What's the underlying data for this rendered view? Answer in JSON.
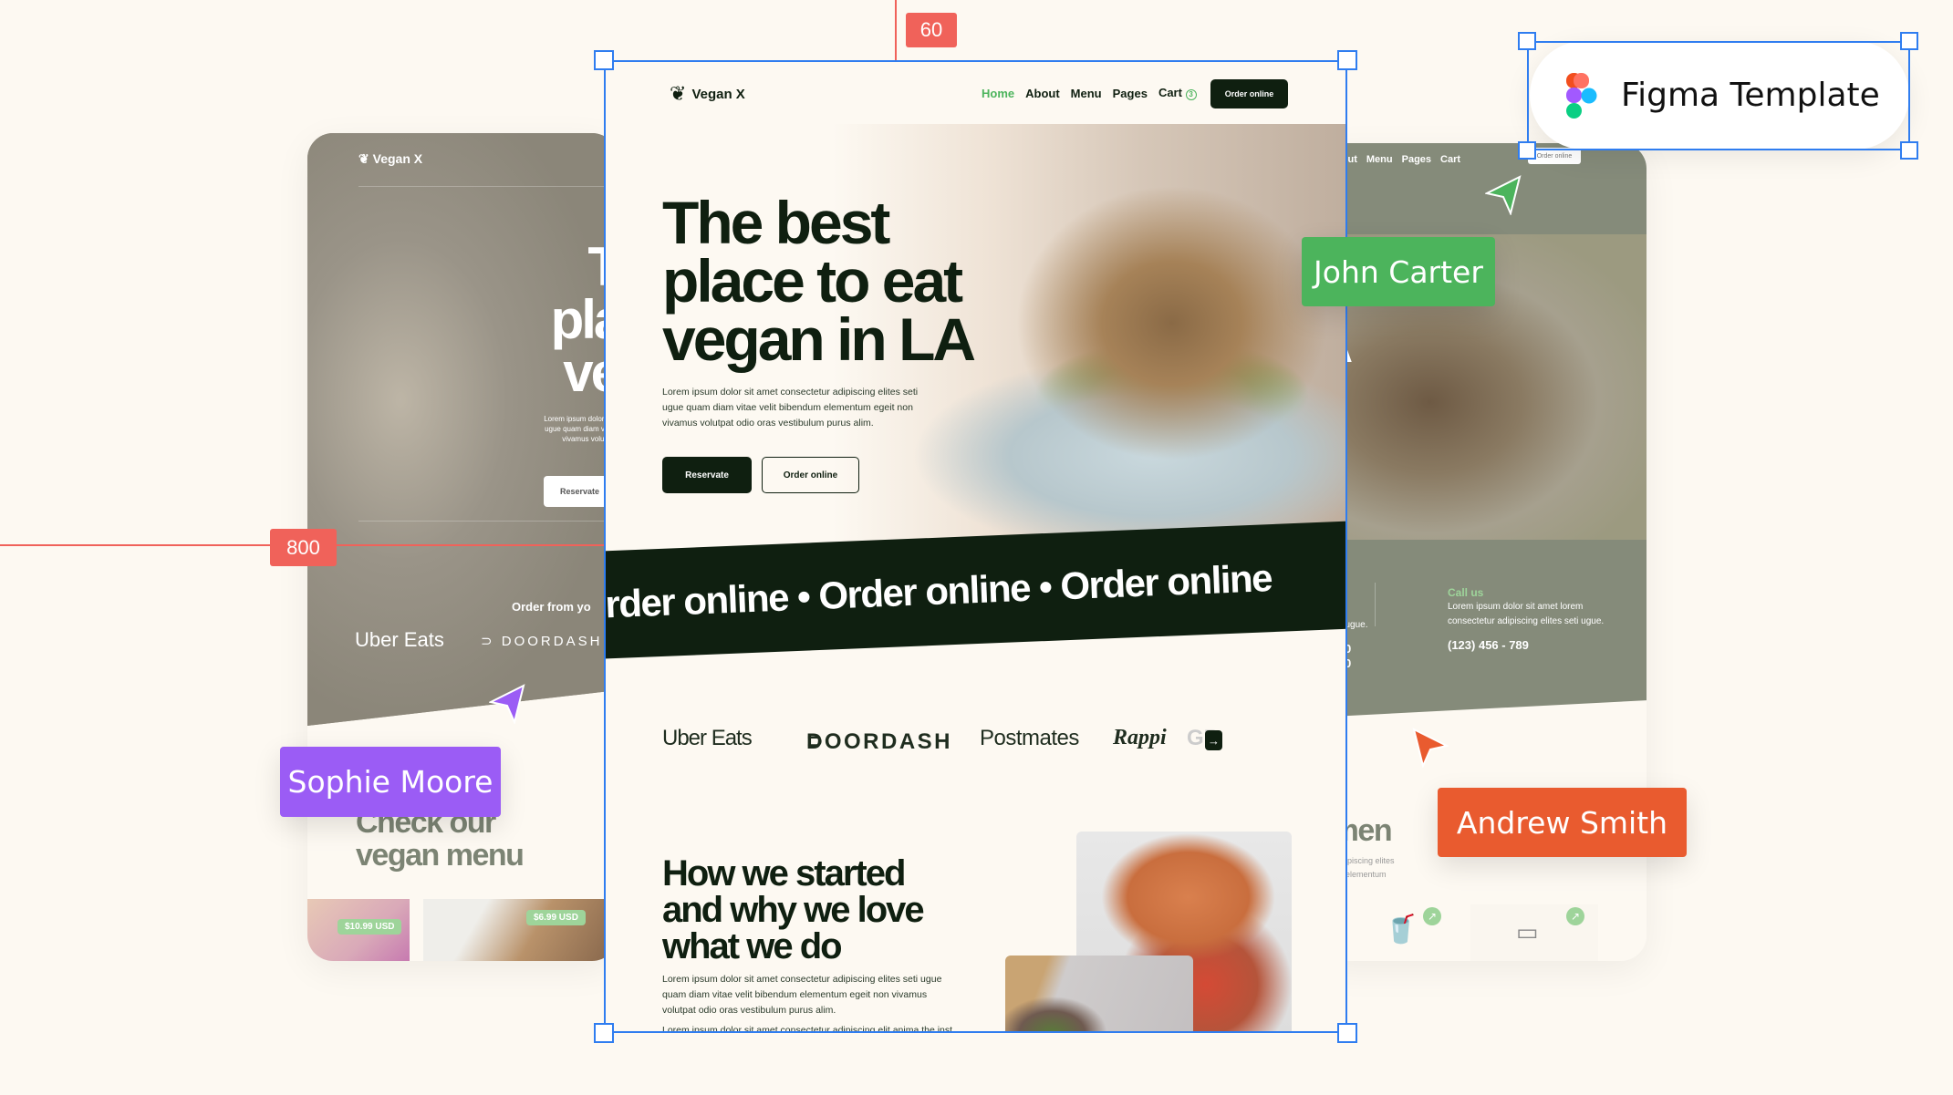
{
  "colors": {
    "accent": "#4cb45c",
    "dark": "#0f1f10",
    "selection": "#2f7df0",
    "guide": "#f0625a",
    "purple": "#9b5cf5",
    "orange": "#e95b2f"
  },
  "guides": {
    "top_label": "60",
    "left_label": "800"
  },
  "figma_badge": {
    "label": "Figma Template",
    "icon": "figma-logo-icon"
  },
  "collaborators": [
    {
      "name": "John Carter",
      "color": "#4cb45c"
    },
    {
      "name": "Sophie Moore",
      "color": "#9b5cf5"
    },
    {
      "name": "Andrew Smith",
      "color": "#e95b2f"
    }
  ],
  "main": {
    "brand": "Vegan X",
    "nav": [
      "Home",
      "About",
      "Menu",
      "Pages",
      "Cart"
    ],
    "cart_count": "3",
    "nav_cta": "Order online",
    "hero_title": [
      "The best",
      "place to eat",
      "vegan in LA"
    ],
    "hero_text": [
      "Lorem ipsum dolor sit amet consectetur adipiscing elites seti",
      "ugue quam diam vitae velit bibendum elementum egeit non",
      "vivamus volutpat odio oras vestibulum purus alim."
    ],
    "reserve_btn": "Reservate",
    "order_btn": "Order online",
    "marquee": "Order online • Order online • Order online",
    "partners": [
      "Uber Eats",
      "DOORDASH",
      "Postmates",
      "Rappi",
      "GR"
    ],
    "about_title": [
      "How we started",
      "and why we love",
      "what we do"
    ],
    "about_text": [
      "Lorem ipsum dolor sit amet consectetur adipiscing elites seti ugue",
      "quam diam vitae velit bibendum elementum egeit non vivamus",
      "volutpat odio oras vestibulum purus alim."
    ],
    "about_text2": "Lorem ipsum dolor sit amet consectetur adipiscing elit anima the inst"
  },
  "left_card": {
    "brand": "Vegan X",
    "hero_title": [
      "The",
      "place",
      "vega"
    ],
    "hero_text": [
      "Lorem ipsum dolor sit ar",
      "ugue quam diam vitae v",
      "vivamus volutpat c"
    ],
    "reserve_btn": "Reservate",
    "order_from": "Order from yo",
    "partners": [
      "Uber Eats",
      "DOORDASH"
    ],
    "menu_title": [
      "Check our",
      "vegan menu"
    ],
    "prices": [
      "$10.99 USD",
      "$6.99 USD"
    ]
  },
  "right_card": {
    "nav": [
      "e",
      "About",
      "Menu",
      "Pages",
      "Cart"
    ],
    "nav_cta": "Order online",
    "hero_partial": "A",
    "hours_text": [
      "t lorem",
      "tes seti ugue."
    ],
    "hours": [
      "- 12:00",
      "- 18:00"
    ],
    "call_title": "Call us",
    "call_text": [
      "Lorem ipsum dolor sit amet lorem",
      "consectetur adipiscing elites seti ugue."
    ],
    "phone": "(123) 456 - 789",
    "menu_partial": "r men",
    "menu_text": [
      "ctetur adipiscing elites",
      "bendum elementum"
    ]
  }
}
